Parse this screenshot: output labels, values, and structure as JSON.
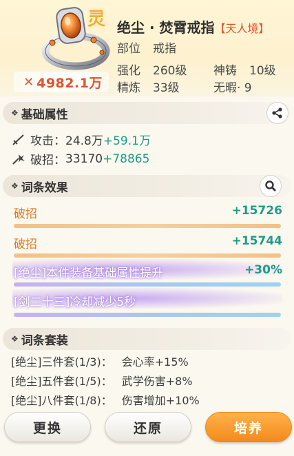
{
  "item": {
    "badge": "灵",
    "name": "绝尘 · 焚霄戒指",
    "realm": "【天人境】",
    "power": "4982.1万",
    "slot_label": "部位",
    "slot_value": "戒指",
    "enhance_label": "强化",
    "enhance_value": "260级",
    "forge_label": "神铸",
    "forge_value": "10级",
    "refine_label": "精炼",
    "refine_value": "33级",
    "flawless_label": "无暇",
    "flawless_value": "· 9"
  },
  "base_attrs": {
    "title": "基础属性",
    "rows": [
      {
        "label": "攻击：",
        "value": "24.8万",
        "plus": "+59.1万",
        "icon": "sword-icon"
      },
      {
        "label": "破招：",
        "value": "33170",
        "plus": "+78865",
        "icon": "break-icon"
      }
    ]
  },
  "affixes": {
    "title": "词条效果",
    "rows": [
      {
        "name": "破招",
        "value": "+15726",
        "color": "#e07a2a"
      },
      {
        "name": "破招",
        "value": "+15744",
        "color": "#e07a2a"
      },
      {
        "name": "[绝尘]本件装备基础属性提升",
        "value": "+30%",
        "color": "#b58cf0"
      },
      {
        "name": "[剑二十三]冷却减少5秒",
        "value": "",
        "color": "#b58cf0"
      }
    ]
  },
  "sets": {
    "title": "词条套装",
    "rows": [
      {
        "name": "[绝尘]三件套(1/3)：",
        "effect": "会心率+15%"
      },
      {
        "name": "[绝尘]五件套(1/5)：",
        "effect": "武学伤害+8%"
      },
      {
        "name": "[绝尘]八件套(1/8)：",
        "effect": "伤害增加+10%"
      }
    ]
  },
  "buttons": {
    "replace": "更换",
    "restore": "还原",
    "cultivate": "培养"
  },
  "colors": {
    "accent_orange": "#f48a1c",
    "plus_green": "#1e9b8a",
    "power_red": "#e0532a"
  }
}
